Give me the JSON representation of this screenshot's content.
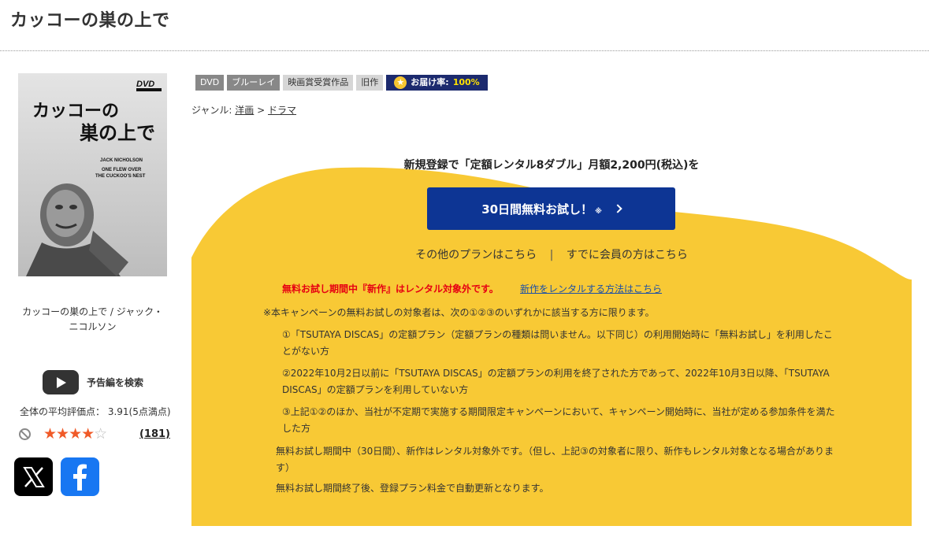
{
  "title": "カッコーの巣の上で",
  "jacket": {
    "title_jp_line1": "カッコーの",
    "title_jp_line2": "巣の上で",
    "dvd_logo": "DVD",
    "cast": "JACK NICHOLSON",
    "en_title_line1": "ONE FLEW OVER",
    "en_title_line2": "THE CUCKOO'S NEST"
  },
  "jacket_caption": "カッコーの巣の上で / ジャック・ニコルソン",
  "trailer": {
    "label": "予告編を検索",
    "icon": "youtube-play-icon"
  },
  "rating": {
    "average_text": "全体の平均評価点： 3.91(5点満点)",
    "average": 3.91,
    "stars_filled": "★★★★",
    "stars_empty": "☆",
    "review_count": "(181)"
  },
  "share": {
    "x_icon": "x-logo-icon",
    "facebook_icon": "facebook-logo-icon"
  },
  "tags": [
    "DVD",
    "ブルーレイ",
    "映画賞受賞作品",
    "旧作"
  ],
  "delivery": {
    "label": "お届け率:",
    "value": "100%"
  },
  "genre": {
    "label": "ジャンル:",
    "items": [
      "洋画",
      "ドラマ"
    ],
    "separator": ">"
  },
  "campaign": {
    "lead": "新規登録で「定額レンタル8ダブル」月額2,200円(税込)を",
    "button_label": "30日間無料お試し！",
    "button_note": "※",
    "other_plans": "その他のプランはこちら",
    "separator": "|",
    "member_link": "すでに会員の方はこちら",
    "notice_red": "無料お試し期間中『新作』はレンタル対象外です。",
    "notice_link": "新作をレンタルする方法はこちら",
    "caution": "※本キャンペーンの無料お試しの対象者は、次の①②③のいずれかに該当する方に限ります。",
    "conditions": [
      "①「TSUTAYA DISCAS」の定額プラン（定額プランの種類は問いません。以下同じ）の利用開始時に「無料お試し」を利用したことがない方",
      "②2022年10月2日以前に「TSUTAYA DISCAS」の定額プランの利用を終了された方であって、2022年10月3日以降、「TSUTAYA DISCAS」の定額プランを利用していない方",
      "③上記①②のほか、当社が不定期で実施する期間限定キャンペーンにおいて、キャンペーン開始時に、当社が定める参加条件を満たした方"
    ],
    "para1": "無料お試し期間中（30日間）、新作はレンタル対象外です。（但し、上記③の対象者に限り、新作もレンタル対象となる場合があります）",
    "para2": "無料お試し期間終了後、登録プラン料金で自動更新となります。"
  },
  "colors": {
    "campaign_yellow": "#f8c935",
    "button_blue": "#0d3594",
    "delivery_badge": "#1c2a6e",
    "notice_red": "#e60012",
    "star_orange": "#f05a28",
    "facebook_blue": "#1877f2"
  }
}
